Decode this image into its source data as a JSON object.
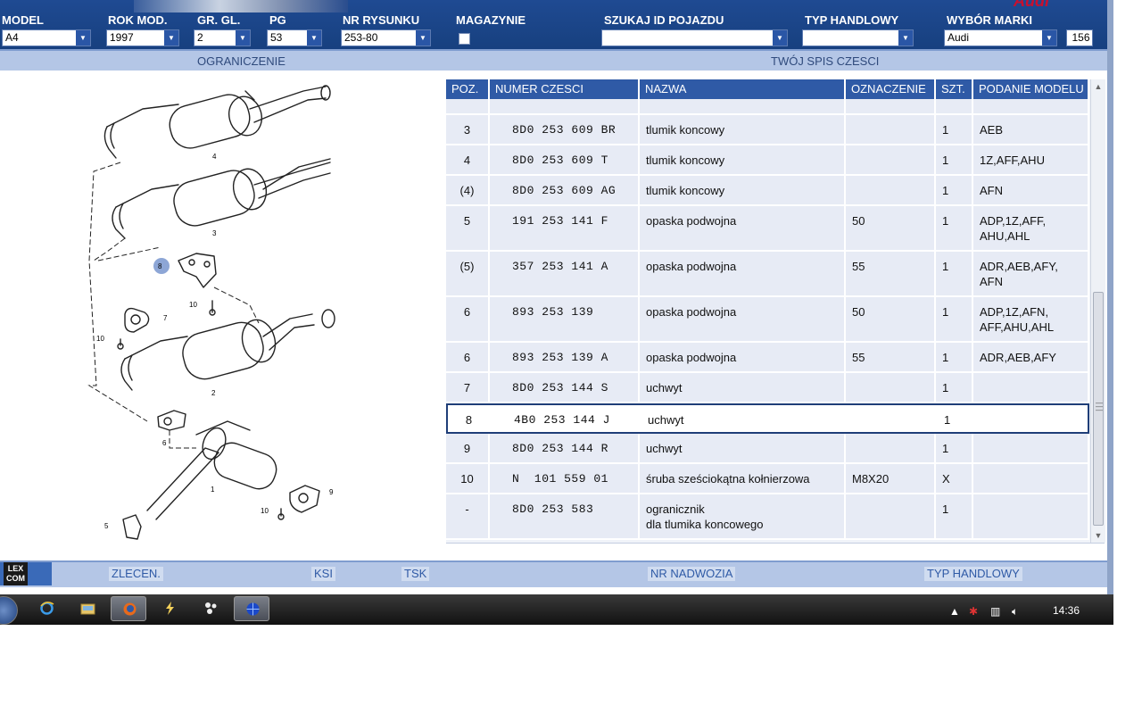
{
  "header": {
    "brand_logo": "Audi",
    "fields": [
      {
        "key": "model",
        "label": "MODEL",
        "value": "A4"
      },
      {
        "key": "rok",
        "label": "ROK MOD.",
        "value": "1997"
      },
      {
        "key": "gr",
        "label": "GR. GL.",
        "value": "2"
      },
      {
        "key": "pg",
        "label": "PG",
        "value": "53"
      },
      {
        "key": "nr",
        "label": "NR RYSUNKU",
        "value": "253-80"
      },
      {
        "key": "mag",
        "label": "MAGAZYNIE",
        "value": ""
      },
      {
        "key": "szukaj",
        "label": "SZUKAJ ID POJAZDU",
        "value": ""
      },
      {
        "key": "typ",
        "label": "TYP HANDLOWY",
        "value": ""
      },
      {
        "key": "marka",
        "label": "WYBÓR MARKI",
        "value": "Audi"
      }
    ],
    "counter": "156"
  },
  "subbar": {
    "left": "OGRANICZENIE",
    "right": "TWÓJ SPIS CZESCI"
  },
  "diagram": {
    "callouts": [
      "4",
      "3",
      "8",
      "10",
      "7",
      "10",
      "2",
      "6",
      "1",
      "9",
      "10",
      "5"
    ],
    "highlight_color": "#8da6d6"
  },
  "table": {
    "headers": [
      "POZ.",
      "NUMER CZESCI",
      "NAZWA",
      "OZNACZENIE",
      "SZT.",
      "PODANIE MODELU"
    ],
    "rows": [
      {
        "poz": "3",
        "num": "8D0 253 609 BR",
        "nazwa": "tlumik koncowy",
        "ozn": "",
        "szt": "1",
        "model": "AEB"
      },
      {
        "poz": "4",
        "num": "8D0 253 609 T",
        "nazwa": "tlumik koncowy",
        "ozn": "",
        "szt": "1",
        "model": "1Z,AFF,AHU"
      },
      {
        "poz": "(4)",
        "num": "8D0 253 609 AG",
        "nazwa": "tlumik koncowy",
        "ozn": "",
        "szt": "1",
        "model": "AFN"
      },
      {
        "poz": "5",
        "num": "191 253 141 F",
        "nazwa": "opaska podwojna",
        "ozn": "50",
        "szt": "1",
        "model": "ADP,1Z,AFF,\nAHU,AHL"
      },
      {
        "poz": "(5)",
        "num": "357 253 141 A",
        "nazwa": "opaska podwojna",
        "ozn": "55",
        "szt": "1",
        "model": "ADR,AEB,AFY,\nAFN"
      },
      {
        "poz": "6",
        "num": "893 253 139",
        "nazwa": "opaska podwojna",
        "ozn": "50",
        "szt": "1",
        "model": "ADP,1Z,AFN,\nAFF,AHU,AHL"
      },
      {
        "poz": "6",
        "num": "893 253 139 A",
        "nazwa": "opaska podwojna",
        "ozn": "55",
        "szt": "1",
        "model": "ADR,AEB,AFY"
      },
      {
        "poz": "7",
        "num": "8D0 253 144 S",
        "nazwa": "uchwyt",
        "ozn": "",
        "szt": "1",
        "model": ""
      },
      {
        "poz": "8",
        "num": "4B0 253 144 J",
        "nazwa": "uchwyt",
        "ozn": "",
        "szt": "1",
        "model": ""
      },
      {
        "poz": "9",
        "num": "8D0 253 144 R",
        "nazwa": "uchwyt",
        "ozn": "",
        "szt": "1",
        "model": ""
      },
      {
        "poz": "10",
        "num": "N  101 559 01",
        "nazwa": "śruba sześciokątna kołnierzowa",
        "ozn": "M8X20",
        "szt": "X",
        "model": ""
      },
      {
        "poz": "-",
        "num": "8D0 253 583",
        "nazwa": "ogranicznik\ndla tlumika koncowego",
        "ozn": "",
        "szt": "1",
        "model": ""
      }
    ],
    "selected_index": 8
  },
  "footer": {
    "logo": "LEX\nCOM",
    "buttons": [
      "ZLECEN.",
      "KSI",
      "TSK",
      "NR NADWOZIA",
      "TYP HANDLOWY"
    ]
  },
  "taskbar": {
    "apps": [
      "internet-explorer",
      "file-explorer",
      "firefox",
      "app-lightning",
      "app-dots",
      "app-globe"
    ],
    "active_apps": [
      "firefox",
      "app-globe"
    ],
    "clock": "14:36"
  }
}
